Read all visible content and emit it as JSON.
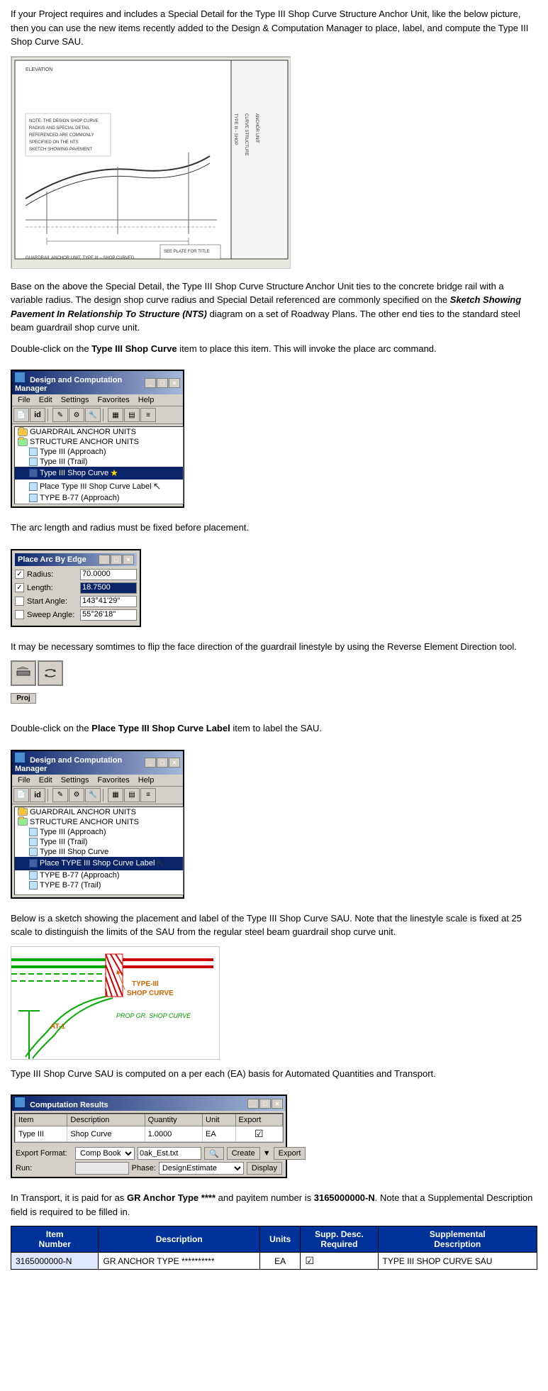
{
  "intro_text": "If your Project requires and includes a Special Detail for the Type III Shop Curve Structure Anchor Unit, like the below picture, then you can use the new items recently added to the Design & Computation Manager to place, label, and compute the Type III Shop Curve SAU.",
  "drawing_title": "GUARDRAIL ANCHOR UNIT, TYPE III - SHOP CURVED",
  "para1": "Base on the above the Special Detail, the Type III Shop Curve Structure Anchor Unit ties to the concrete bridge rail with a variable radius. The design shop curve radius and Special Detail referenced are commonly specified on the ",
  "para1_bold": "Sketch Showing Pavement In Relationship To Structure (NTS)",
  "para1_end": " diagram on a set of Roadway Plans. The other end ties to the standard steel beam guardrail shop curve unit.",
  "para2_prefix": "Double-click on the ",
  "para2_bold": "Type III Shop Curve",
  "para2_suffix": " item to place this item. This will invoke the place arc command.",
  "dcm_title1": "Design and Computation Manager",
  "menu_items1": [
    "File",
    "Edit",
    "Settings",
    "Favorites",
    "Help"
  ],
  "tree1": {
    "items": [
      {
        "label": "GUARDRAIL ANCHOR UNITS",
        "type": "folder",
        "level": 0
      },
      {
        "label": "STRUCTURE ANCHOR UNITS",
        "type": "folder",
        "level": 0
      },
      {
        "label": "Type III (Approach)",
        "type": "item",
        "level": 1
      },
      {
        "label": "Type III (Trail)",
        "type": "item",
        "level": 1
      },
      {
        "label": "Type III Shop Curve",
        "type": "item",
        "level": 1,
        "selected": true,
        "star": true
      },
      {
        "label": "Place Type III Shop Curve Label",
        "type": "item",
        "level": 1
      },
      {
        "label": "TYPE B-77 (Approach)",
        "type": "item",
        "level": 1
      }
    ]
  },
  "arc_title": "Place Arc By Edge",
  "arc_fields": [
    {
      "checked": true,
      "label": "Radius:",
      "value": "70.0000",
      "highlighted": false
    },
    {
      "checked": true,
      "label": "Length:",
      "value": "18.7500",
      "highlighted": true
    },
    {
      "checked": false,
      "label": "Start Angle:",
      "value": "143°41'29\"",
      "highlighted": false
    },
    {
      "checked": false,
      "label": "Sweep Angle:",
      "value": "55°26'18\"",
      "highlighted": false
    }
  ],
  "tools_label": "Proj",
  "para3": "The arc length and radius must be fixed before placement.",
  "para4_prefix": "It may be necessary somtimes to flip the face direction of the guardrail linestyle by using the Reverse Element Direction tool.",
  "para5_prefix": "Double-click on the ",
  "para5_bold": "Place Type III Shop Curve Label",
  "para5_suffix": " item to label the SAU.",
  "dcm_title2": "Design and Computation Manager",
  "menu_items2": [
    "File",
    "Edit",
    "Settings",
    "Favorites",
    "Help"
  ],
  "tree2": {
    "items": [
      {
        "label": "GUARDRAIL ANCHOR UNITS",
        "type": "folder",
        "level": 0
      },
      {
        "label": "STRUCTURE ANCHOR UNITS",
        "type": "folder",
        "level": 0
      },
      {
        "label": "Type III (Approach)",
        "type": "item",
        "level": 1
      },
      {
        "label": "Type III (Trail)",
        "type": "item",
        "level": 1
      },
      {
        "label": "Type III Shop Curve",
        "type": "item",
        "level": 1
      },
      {
        "label": "Place TYPE III Shop Curve Label",
        "type": "item",
        "level": 1,
        "selected": true
      },
      {
        "label": "TYPE B-77 (Approach)",
        "type": "item",
        "level": 1
      },
      {
        "label": "TYPE B-77 (Trail)",
        "type": "item",
        "level": 1
      }
    ]
  },
  "para6": "Below is a sketch showing the placement and label of the Type III Shop Curve SAU. Note that the linestyle scale is fixed at 25 scale to distinguish the limits of the SAU from the regular steel beam guardrail shop curve unit.",
  "sketch_labels": {
    "type3": "TYPE-III\nSHOP CURVE",
    "prop_gr": "PROP GR. SHOP CURVE",
    "at1": "AT-1"
  },
  "para7": "Type III Shop Curve SAU is computed on a per each (EA) basis for Automated Quantities and Transport.",
  "comp_title": "Computation Results",
  "comp_table_headers": [
    "Item",
    "Description",
    "Quantity",
    "Unit",
    "Export"
  ],
  "comp_table_rows": [
    {
      "item": "Type III",
      "description": "Shop Curve",
      "quantity": "1.0000",
      "unit": "EA",
      "export": true
    }
  ],
  "export_format_label": "Export Format:",
  "export_format_value": "Comp Book",
  "export_file": "0ak_Est.txt",
  "create_btn": "Create",
  "export_btn": "Export",
  "run_label": "Run:",
  "phase_label": "Phase:",
  "phase_value": "DesignEstimate",
  "display_btn": "Display",
  "para8_prefix": "In Transport,  it is paid for as ",
  "para8_bold1": "GR Anchor Type ****",
  "para8_mid": " and payitem number is ",
  "para8_bold2": "3165000000-N",
  "para8_end": ".  Note that a Supplemental Description field is required to be filled in.",
  "bottom_table": {
    "headers": [
      "Item\nNumber",
      "Description",
      "Units",
      "Supp. Desc.\nRequired",
      "Supplemental\nDescription"
    ],
    "rows": [
      {
        "item": "3165000000-N",
        "description": "GR ANCHOR TYPE **********",
        "units": "EA",
        "supp_req": true,
        "supp_desc": "TYPE III SHOP CURVE SAU"
      }
    ]
  }
}
